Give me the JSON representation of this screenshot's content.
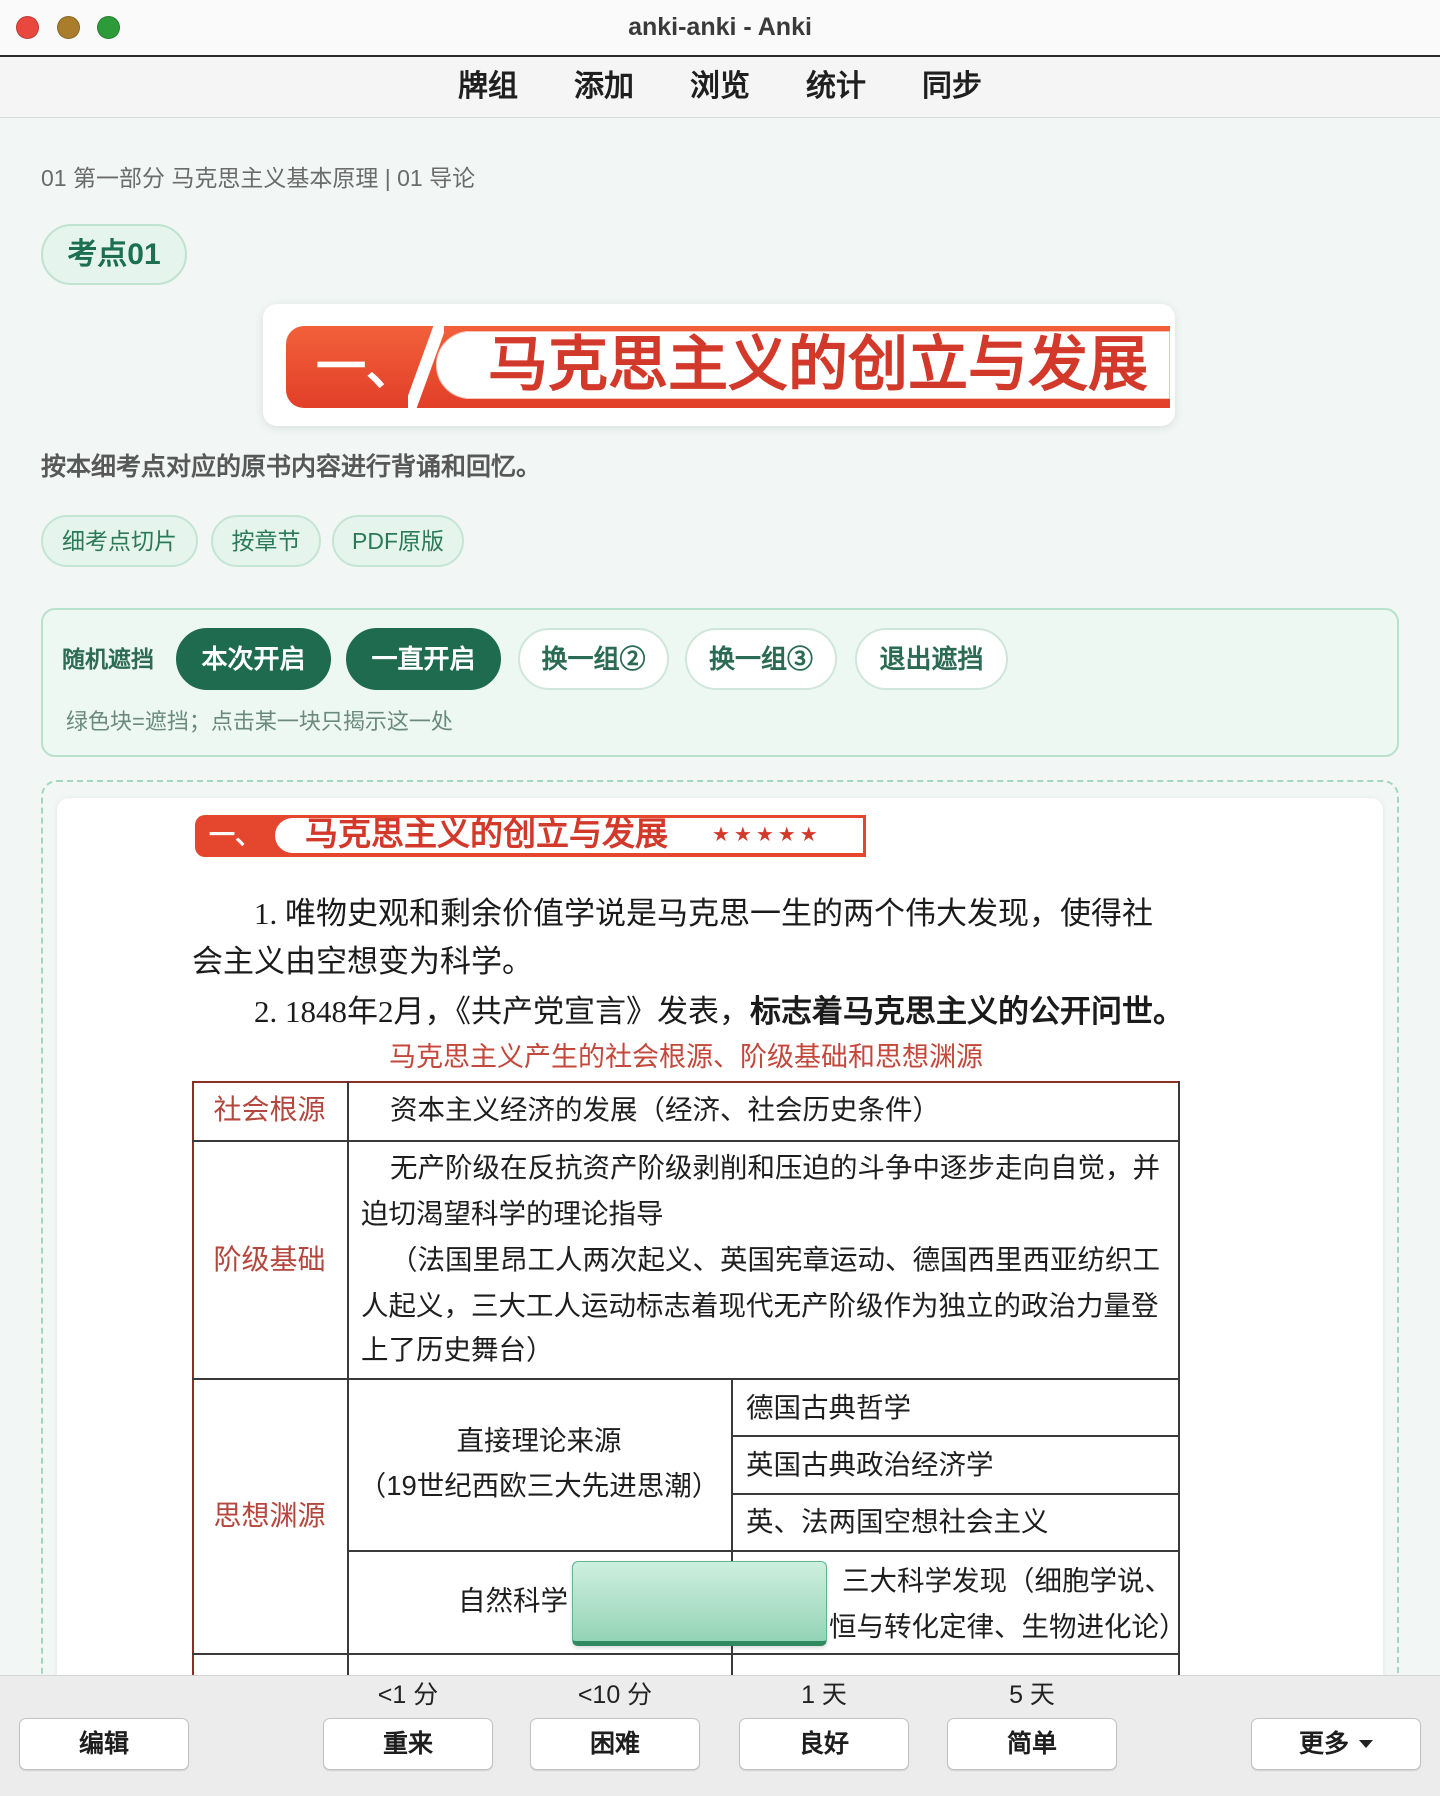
{
  "window": {
    "title": "anki-anki - Anki"
  },
  "menu": {
    "items": [
      "牌组",
      "添加",
      "浏览",
      "统计",
      "同步"
    ]
  },
  "card": {
    "breadcrumb": "01 第一部分 马克思主义基本原理 | 01 导论",
    "tag": "考点01",
    "banner": {
      "number": "一、",
      "title": "马克思主义的创立与发展"
    },
    "instruction": "按本细考点对应的原书内容进行背诵和回忆。",
    "filters": [
      "细考点切片",
      "按章节",
      "PDF原版"
    ],
    "occlusion": {
      "label": "随机遮挡",
      "buttons": [
        {
          "label": "本次开启",
          "active": true
        },
        {
          "label": "一直开启",
          "active": true
        },
        {
          "label": "换一组②",
          "active": false
        },
        {
          "label": "换一组③",
          "active": false
        },
        {
          "label": "退出遮挡",
          "active": false
        }
      ],
      "hint": "绿色块=遮挡；点击某一块只揭示这一处"
    },
    "scan": {
      "banner": {
        "number": "一、",
        "title": "马克思主义的创立与发展",
        "stars": "★★★★★"
      },
      "lines": [
        "1. 唯物史观和剩余价值学说是马克思一生的两个伟大发现，使得社",
        "会主义由空想变为科学。"
      ],
      "line3": {
        "plain": "2. 1848年2月，《共产党宣言》发表，",
        "bold": "标志着马克思主义的公开问世",
        "end": "。"
      },
      "table_title": "马克思主义产生的社会根源、阶级基础和思想渊源",
      "table": {
        "social": {
          "label": "社会根源",
          "content": "资本主义经济的发展（经济、社会历史条件）"
        },
        "class": {
          "label": "阶级基础",
          "lines": [
            "无产阶级在反抗资产阶级剥削和压迫的斗争中逐步走向自觉，并",
            "迫切渴望科学的理论指导",
            "（法国里昂工人两次起义、英国宪章运动、德国西里西亚纺织工",
            "人起义，三大工人运动标志着现代无产阶级作为独立的政治力量登",
            "上了历史舞台）"
          ]
        },
        "thought": {
          "label": "思想渊源",
          "direct": {
            "title": "直接理论来源",
            "note": "（19世纪西欧三大先进思潮）",
            "items": [
              "德国古典哲学",
              "英国古典政治经济学",
              "英、法两国空想社会主义"
            ]
          },
          "science": {
            "title": "自然科学",
            "lines": [
              "三大科学发现（细胞学说、",
              "恒与转化定律、生物进化论）"
            ]
          }
        }
      }
    }
  },
  "review": {
    "intervals": [
      "<1 分",
      "<10 分",
      "1 天",
      "5 天"
    ],
    "edit": "编辑",
    "answers": [
      "重来",
      "困难",
      "良好",
      "简单"
    ],
    "more": "更多"
  },
  "icons": {
    "more_menu": "caret-down-icon",
    "window_controls": [
      "close-window-button",
      "minimize-window-button",
      "zoom-window-button"
    ]
  },
  "colors": {
    "accent": "#1e6b50",
    "accent_soft": "#e5f4ec",
    "page_bg": "#f2f7f5",
    "scan_red": "#d3392a",
    "mask_top": "#cdefdf",
    "mask_bottom": "#93d4b5",
    "close": "#e9483f",
    "minimize": "#a97d2c",
    "zoom": "#2e9b3a"
  }
}
